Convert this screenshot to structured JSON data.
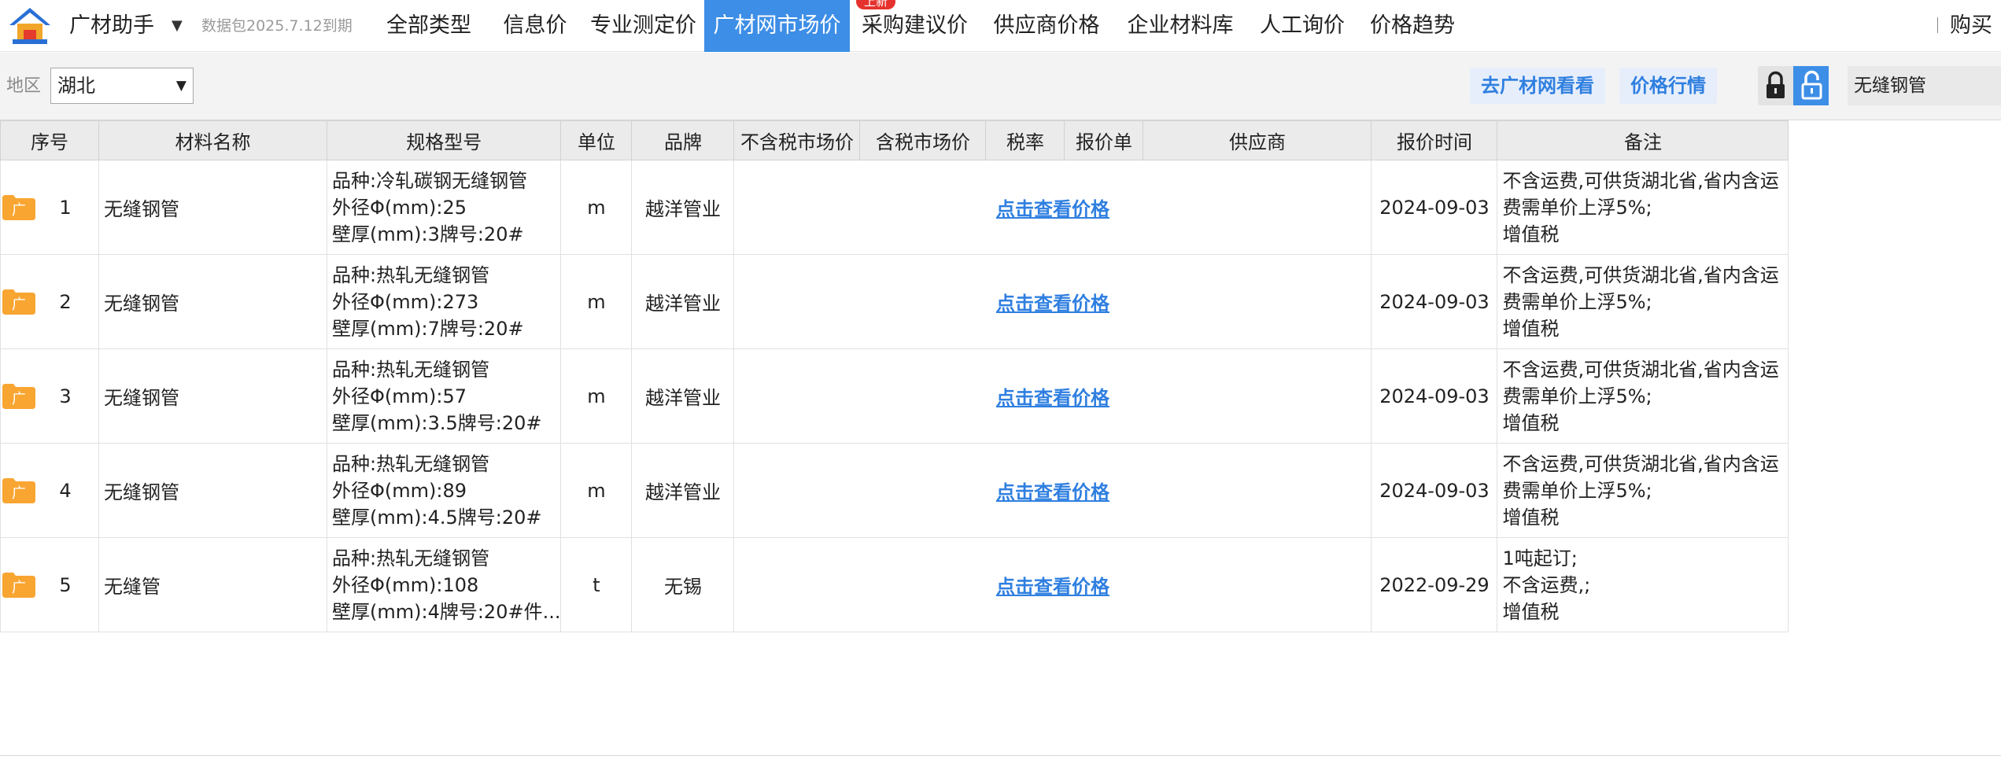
{
  "colors": {
    "accent": "#3d8ee6",
    "link": "#2f7fe0",
    "badge": "#e5322d",
    "tag": "#f8a532"
  },
  "app": {
    "title": "广材助手",
    "expiry": "数据包2025.7.12到期",
    "logo_icon": "guangcai-logo-icon"
  },
  "nav": {
    "tabs": [
      {
        "label": "全部类型"
      },
      {
        "label": "信息价"
      },
      {
        "label": "专业测定价"
      },
      {
        "label": "广材网市场价",
        "active": true
      },
      {
        "label": "采购建议价",
        "badge": "上新"
      },
      {
        "label": "供应商价格"
      },
      {
        "label": "企业材料库"
      },
      {
        "label": "人工询价"
      },
      {
        "label": "价格趋势"
      }
    ],
    "buy": "购买"
  },
  "filter": {
    "region_label": "地区",
    "region_value": "湖北",
    "goto_site": "去广材网看看",
    "price_trend": "价格行情",
    "search_value": "无缝钢管"
  },
  "table": {
    "columns": [
      "序号",
      "材料名称",
      "规格型号",
      "单位",
      "品牌",
      "不含税市场价",
      "含税市场价",
      "税率",
      "报价单",
      "供应商",
      "报价时间",
      "备注"
    ],
    "tag_text": "广",
    "rows": [
      {
        "seq": "1",
        "name": "无缝钢管",
        "spec": [
          "品种:冷轧碳钢无缝钢管",
          "外径Φ(mm):25",
          "壁厚(mm):3牌号:20#"
        ],
        "unit": "m",
        "brand": "越洋管业",
        "price_link": "点击查看价格",
        "date": "2024-09-03",
        "note": [
          "不含运费,可供货湖北省,省内含运",
          "费需单价上浮5%;",
          "增值税"
        ]
      },
      {
        "seq": "2",
        "name": "无缝钢管",
        "spec": [
          "品种:热轧无缝钢管",
          "外径Φ(mm):273",
          "壁厚(mm):7牌号:20#"
        ],
        "unit": "m",
        "brand": "越洋管业",
        "price_link": "点击查看价格",
        "date": "2024-09-03",
        "note": [
          "不含运费,可供货湖北省,省内含运",
          "费需单价上浮5%;",
          "增值税"
        ]
      },
      {
        "seq": "3",
        "name": "无缝钢管",
        "spec": [
          "品种:热轧无缝钢管",
          "外径Φ(mm):57",
          "壁厚(mm):3.5牌号:20#"
        ],
        "unit": "m",
        "brand": "越洋管业",
        "price_link": "点击查看价格",
        "date": "2024-09-03",
        "note": [
          "不含运费,可供货湖北省,省内含运",
          "费需单价上浮5%;",
          "增值税"
        ]
      },
      {
        "seq": "4",
        "name": "无缝钢管",
        "spec": [
          "品种:热轧无缝钢管",
          "外径Φ(mm):89",
          "壁厚(mm):4.5牌号:20#"
        ],
        "unit": "m",
        "brand": "越洋管业",
        "price_link": "点击查看价格",
        "date": "2024-09-03",
        "note": [
          "不含运费,可供货湖北省,省内含运",
          "费需单价上浮5%;",
          "增值税"
        ]
      },
      {
        "seq": "5",
        "name": "无缝管",
        "spec": [
          "品种:热轧无缝钢管",
          "外径Φ(mm):108",
          "壁厚(mm):4牌号:20#件..."
        ],
        "unit": "t",
        "brand": "无锡",
        "price_link": "点击查看价格",
        "date": "2022-09-29",
        "note": [
          "1吨起订;",
          "不含运费,;",
          "增值税"
        ]
      }
    ]
  }
}
